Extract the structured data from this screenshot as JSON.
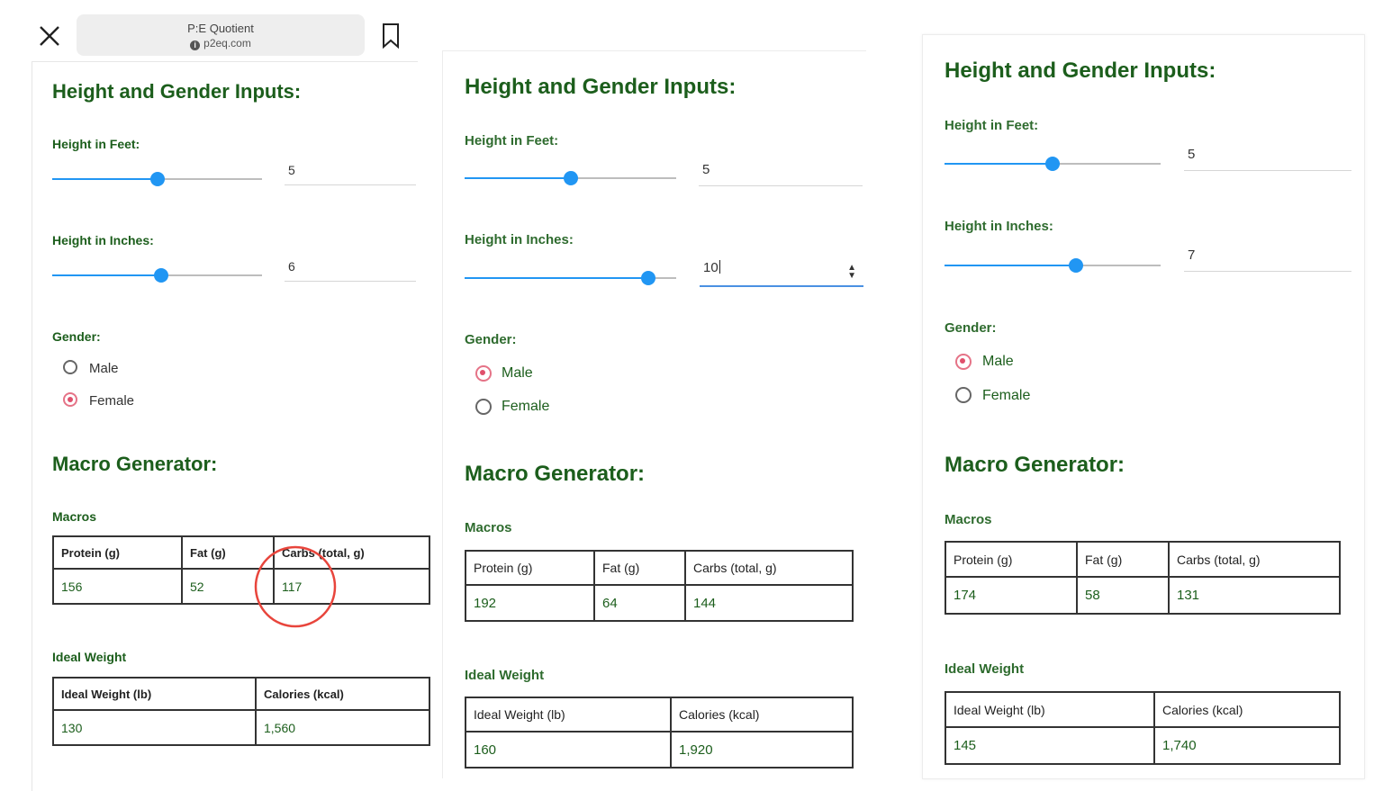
{
  "browser": {
    "title": "P:E Quotient",
    "domain": "p2eq.com"
  },
  "labels": {
    "height_gender_heading": "Height and Gender Inputs:",
    "height_feet": "Height in Feet:",
    "height_inches": "Height in Inches:",
    "gender": "Gender:",
    "male": "Male",
    "female": "Female",
    "macro_heading": "Macro Generator:",
    "macros": "Macros",
    "ideal_weight": "Ideal Weight",
    "protein": "Protein (g)",
    "fat": "Fat (g)",
    "carbs": "Carbs (total, g)",
    "ideal_weight_lb": "Ideal Weight (lb)",
    "calories": "Calories (kcal)"
  },
  "panels": [
    {
      "feet": "5",
      "inches": "6",
      "feet_slider_pct": 50,
      "inches_slider_pct": 52,
      "gender_selected": "Female",
      "protein": "156",
      "fat": "52",
      "carbs": "117",
      "ideal_weight": "130",
      "calories": "1,560"
    },
    {
      "feet": "5",
      "inches": "10",
      "feet_slider_pct": 50,
      "inches_slider_pct": 87,
      "gender_selected": "Male",
      "protein": "192",
      "fat": "64",
      "carbs": "144",
      "ideal_weight": "160",
      "calories": "1,920"
    },
    {
      "feet": "5",
      "inches": "7",
      "feet_slider_pct": 50,
      "inches_slider_pct": 61,
      "gender_selected": "Male",
      "protein": "174",
      "fat": "58",
      "carbs": "131",
      "ideal_weight": "145",
      "calories": "1,740"
    }
  ],
  "colors": {
    "heading": "#1c5e1c",
    "slider": "#2196f3",
    "radio_selected": "#e0506c",
    "highlight_circle": "#e8453c"
  }
}
